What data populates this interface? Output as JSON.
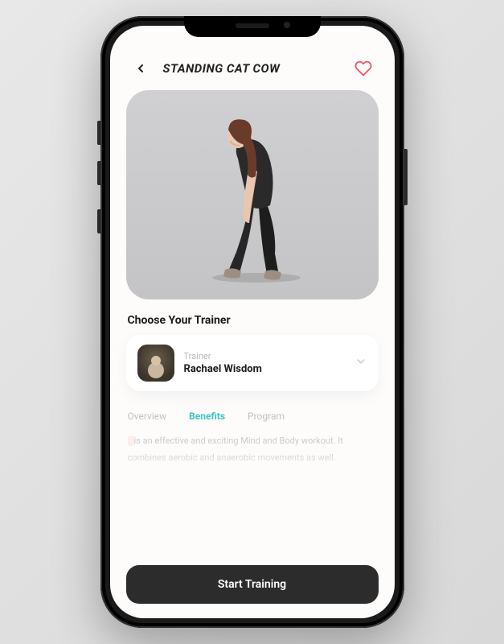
{
  "header": {
    "title": "STANDING CAT COW"
  },
  "trainer": {
    "section_title": "Choose Your Trainer",
    "label": "Trainer",
    "name": "Rachael Wisdom"
  },
  "tabs": {
    "overview": "Overview",
    "benefits": "Benefits",
    "program": "Program",
    "active": "benefits"
  },
  "description": {
    "highlight": "        ",
    "rest": " is an effective and exciting Mind and Body workout. It combines aerobic and anaerobic movements as well."
  },
  "cta": {
    "label": "Start Training"
  },
  "icons": {
    "back": "chevron-left-icon",
    "heart": "heart-icon",
    "chevron": "chevron-down-icon"
  },
  "colors": {
    "accent": "#3fc4c0",
    "heart": "#f05562",
    "cta_bg": "#2c2c2c"
  }
}
